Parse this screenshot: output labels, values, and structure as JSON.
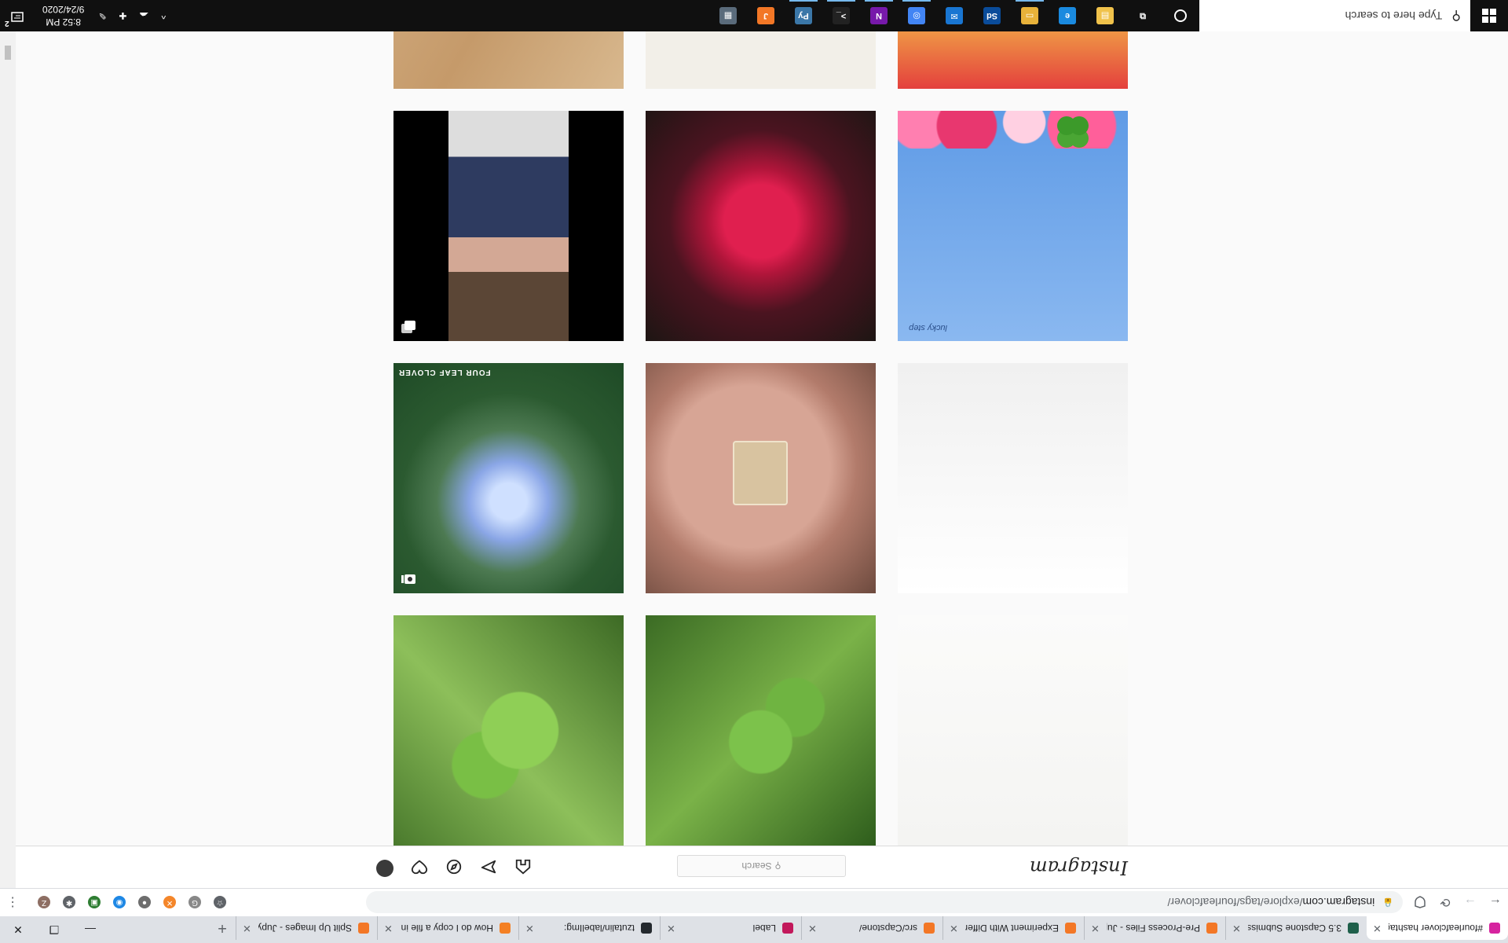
{
  "browser": {
    "tabs": [
      {
        "label": "#fourleafclover hashtag on",
        "favicon_color": "#d6249f",
        "active": true
      },
      {
        "label": "3.5 Capstone Submission -",
        "favicon_color": "#1e5f4a",
        "active": false
      },
      {
        "label": "Pre-Process Files - Jupyter",
        "favicon_color": "#f37726",
        "active": false
      },
      {
        "label": "Experiment With Different",
        "favicon_color": "#f37726",
        "active": false
      },
      {
        "label": "src/Capstone/",
        "favicon_color": "#f37726",
        "active": false
      },
      {
        "label": "Label",
        "favicon_color": "#c2185b",
        "active": false
      },
      {
        "label": "tzutalin/labelImg:",
        "favicon_color": "#24292e",
        "active": false
      },
      {
        "label": "How do I copy a file in Pyth",
        "favicon_color": "#f48024",
        "active": false
      },
      {
        "label": "Split Up Images - Jupyter N",
        "favicon_color": "#f37726",
        "active": false
      }
    ],
    "new_tab_glyph": "+",
    "window_controls": {
      "minimize": "—",
      "maximize": "❐",
      "close": "✕"
    },
    "nav": {
      "back": "←",
      "forward": "→",
      "reload": "⟳"
    },
    "url_host": "instagram.com",
    "url_path": "/explore/tags/fourleafclover/",
    "extensions": [
      {
        "name": "bookmark-star-icon",
        "glyph": "☆",
        "color": "#5f6368"
      },
      {
        "name": "grammarly-icon",
        "glyph": "G",
        "color": "#888888"
      },
      {
        "name": "extension-orange-icon",
        "glyph": "✕",
        "color": "#f4862a"
      },
      {
        "name": "extension-dark-icon",
        "glyph": "●",
        "color": "#6d6d6d"
      },
      {
        "name": "extension-blue-icon",
        "glyph": "◉",
        "color": "#1e88e5"
      },
      {
        "name": "extension-green-icon",
        "glyph": "▣",
        "color": "#2e7d32"
      },
      {
        "name": "puzzle-icon",
        "glyph": "✱",
        "color": "#5f6368"
      },
      {
        "name": "profile-icon",
        "glyph": "Z",
        "color": "#8d6e63"
      }
    ],
    "menu_glyph": "⋮"
  },
  "instagram": {
    "logo": "Instagram",
    "search_placeholder": "Search",
    "nav_icons": [
      "home-icon",
      "messenger-icon",
      "explore-icon",
      "heart-icon",
      "avatar"
    ]
  },
  "posts": [
    {
      "name": "bracelets-white",
      "art": "p-bracelets",
      "badge": null
    },
    {
      "name": "clover-grass-1",
      "art": "p-clover1",
      "badge": null
    },
    {
      "name": "clover-grass-2",
      "art": "p-clover2",
      "badge": null
    },
    {
      "name": "bead-bracelets-color",
      "art": "p-beads",
      "badge": null
    },
    {
      "name": "pressed-clover-hand",
      "art": "p-hand",
      "badge": null
    },
    {
      "name": "kaleidoscope-forest",
      "art": "p-kaleido",
      "badge": "video"
    },
    {
      "name": "blue-sky-clover",
      "art": "p-sky",
      "badge": null
    },
    {
      "name": "red-rose",
      "art": "p-rose",
      "badge": null
    },
    {
      "name": "portrait-woman",
      "art": "p-portrait",
      "badge": "multiple"
    },
    {
      "name": "cupcakes-colorful",
      "art": "p-cupcakes",
      "badge": null
    },
    {
      "name": "book-rings",
      "art": "p-book",
      "badge": null
    },
    {
      "name": "green-bracelet-wood",
      "art": "p-wood",
      "badge": null
    }
  ],
  "posts_text": {
    "sky_watermark": "lucky step",
    "kaleido_caption": "FOUR LEAF CLOVER"
  },
  "taskbar": {
    "search_placeholder": "Type here to search",
    "apps": [
      {
        "name": "task-view-icon",
        "glyph": "⧉",
        "color": "#101010",
        "open": false
      },
      {
        "name": "file-explorer-icon",
        "glyph": "▤",
        "color": "#f0c24b",
        "open": false
      },
      {
        "name": "edge-icon",
        "glyph": "e",
        "color": "#1a8adf",
        "open": false
      },
      {
        "name": "folder-icon",
        "glyph": "▭",
        "color": "#e8b23a",
        "open": true
      },
      {
        "name": "photoshop-icon",
        "glyph": "Sd",
        "color": "#0a4c9a",
        "open": false
      },
      {
        "name": "mail-icon",
        "glyph": "✉",
        "color": "#1976d2",
        "open": false
      },
      {
        "name": "chrome-icon",
        "glyph": "◎",
        "color": "#4285f4",
        "open": true
      },
      {
        "name": "onenote-icon",
        "glyph": "N",
        "color": "#7719aa",
        "open": true
      },
      {
        "name": "terminal-icon",
        "glyph": ">_",
        "color": "#222222",
        "open": true
      },
      {
        "name": "python-icon",
        "glyph": "Py",
        "color": "#3b77a8",
        "open": true
      },
      {
        "name": "jupyter-icon",
        "glyph": "J",
        "color": "#f37726",
        "open": false
      },
      {
        "name": "calculator-icon",
        "glyph": "▦",
        "color": "#5a6b7b",
        "open": false
      }
    ],
    "tray_icons": [
      "^",
      "☁",
      "✚",
      "✎"
    ],
    "time": "8:52 PM",
    "date": "9/24/2020",
    "notification_count": "2"
  }
}
